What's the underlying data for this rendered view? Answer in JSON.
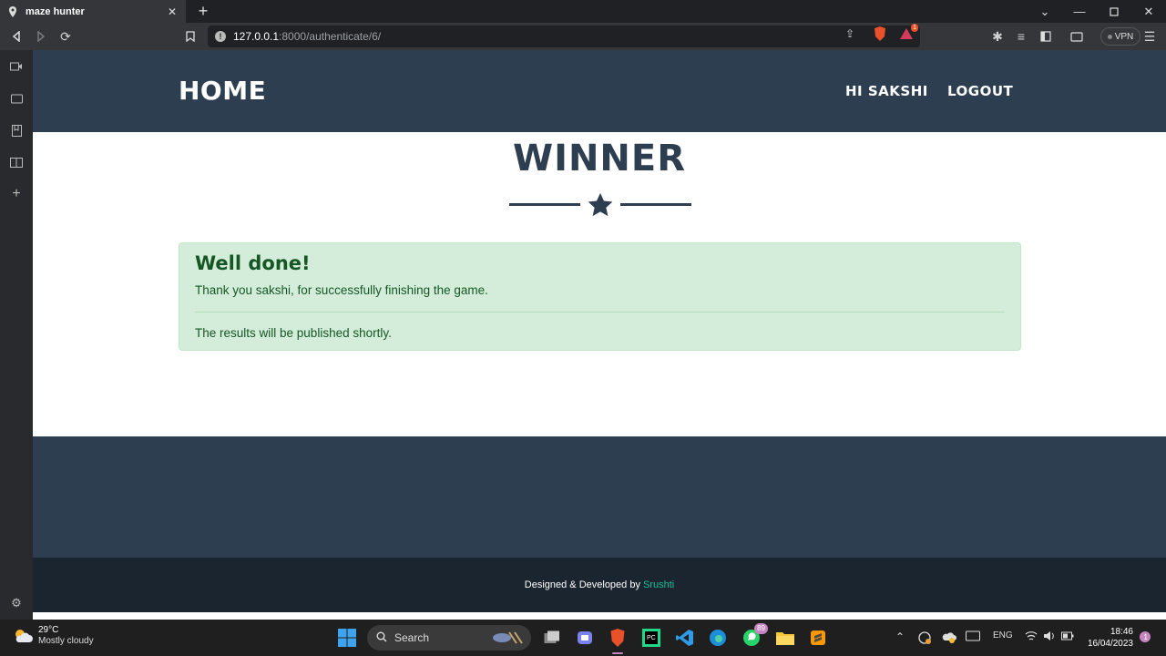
{
  "browser": {
    "tab_title": "maze hunter",
    "url_host": "127.0.0.1",
    "url_path": ":8000/authenticate/6/",
    "vpn_label": "VPN",
    "shield_badge": "1"
  },
  "nav": {
    "brand": "HOME",
    "greeting": "HI SAKSHI",
    "logout": "LOGOUT"
  },
  "main": {
    "heading": "WINNER",
    "alert": {
      "title": "Well done!",
      "message": "Thank you sakshi, for successfully finishing the game.",
      "note": "The results will be published shortly."
    }
  },
  "footer": {
    "credit": "Designed & Developed by",
    "author": "Srushti"
  },
  "taskbar": {
    "temperature": "29°C",
    "condition": "Mostly cloudy",
    "search_label": "Search",
    "whatsapp_badge": "89",
    "language": "ENG",
    "time": "18:46",
    "date": "16/04/2023"
  },
  "colors": {
    "navbar": "#2c3e50",
    "footer_dark": "#1a252f",
    "alert_bg": "#d4edda",
    "alert_text": "#155724",
    "accent": "#18bc9c"
  }
}
